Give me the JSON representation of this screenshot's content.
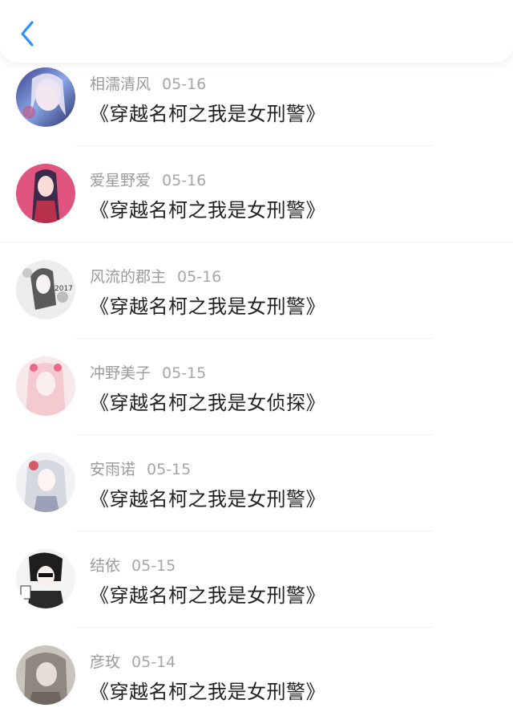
{
  "header": {
    "back_icon": "chevron-left-icon",
    "accent": "#2f8fff"
  },
  "comments": [
    {
      "user": "相濡清风",
      "date": "05-16",
      "text": "《穿越名柯之我是女刑警》"
    },
    {
      "user": "爱星野爱",
      "date": "05-16",
      "text": "《穿越名柯之我是女刑警》"
    },
    {
      "user": "风流的郡主",
      "date": "05-16",
      "text": "《穿越名柯之我是女刑警》"
    },
    {
      "user": "冲野美子",
      "date": "05-15",
      "text": "《穿越名柯之我是女侦探》"
    },
    {
      "user": "安雨诺",
      "date": "05-15",
      "text": "《穿越名柯之我是女刑警》"
    },
    {
      "user": "结依",
      "date": "05-15",
      "text": "《穿越名柯之我是女刑警》"
    },
    {
      "user": "彦玫",
      "date": "05-14",
      "text": "《穿越名柯之我是女刑警》"
    }
  ]
}
